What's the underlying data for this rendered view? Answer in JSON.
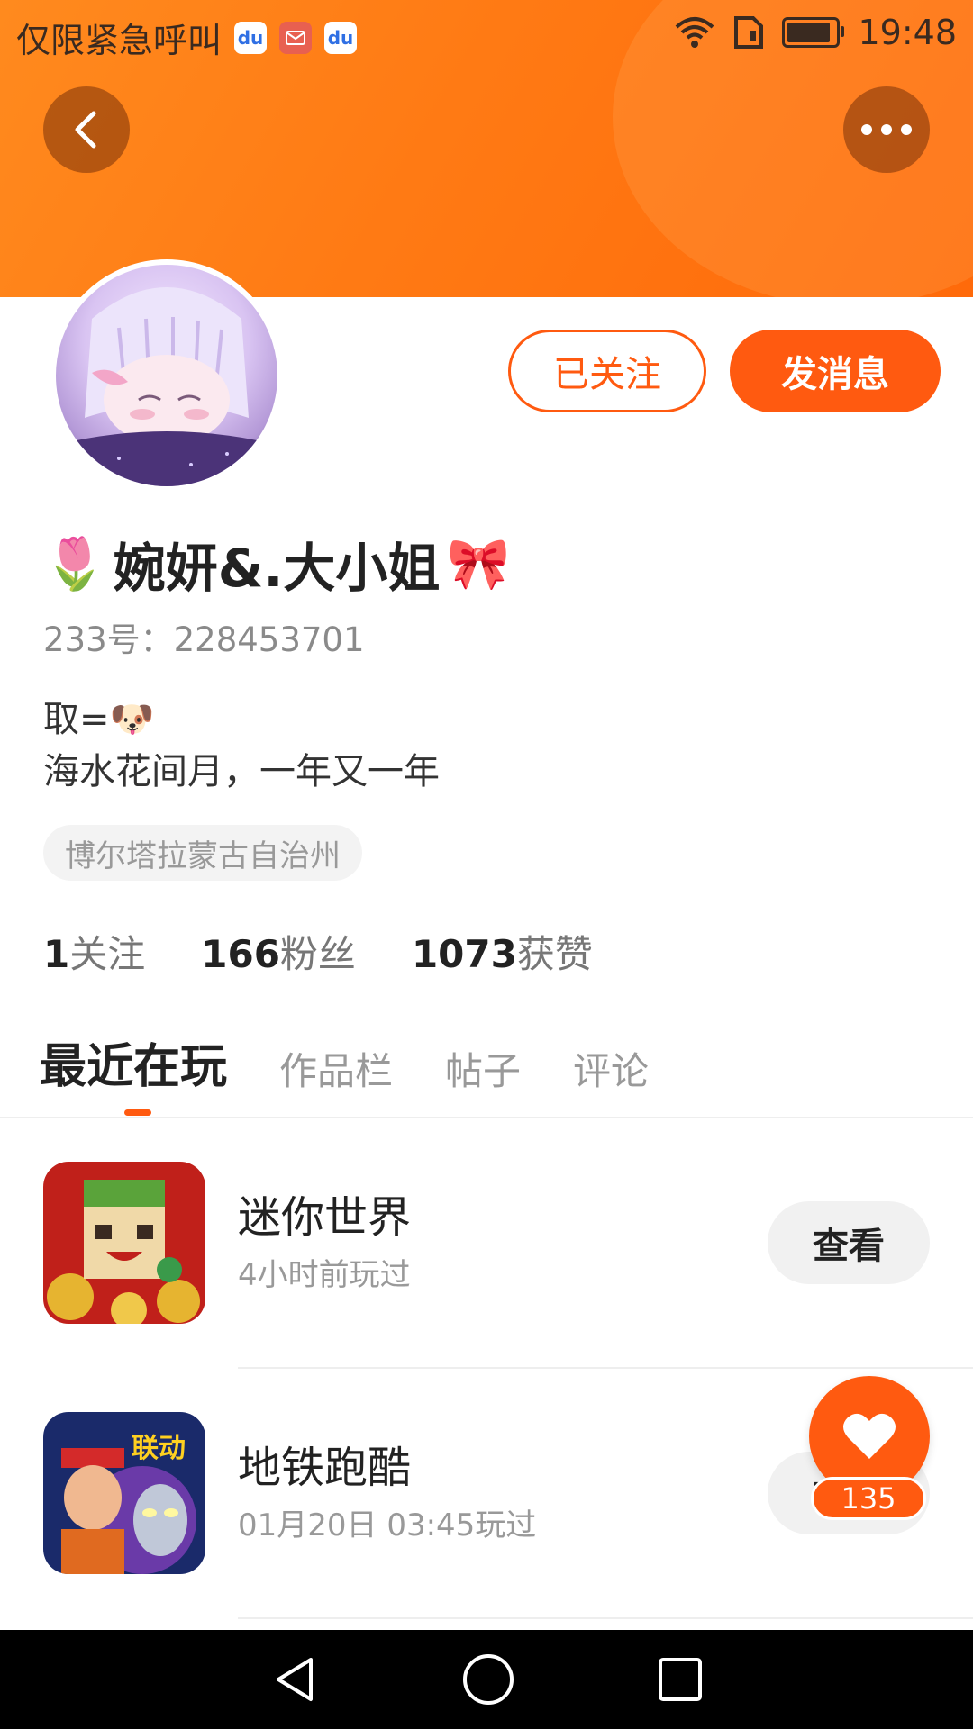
{
  "status_bar": {
    "carrier": "仅限紧急呼叫",
    "apps": [
      "baidu-icon",
      "mail-icon",
      "baidu-icon"
    ],
    "baidu_label": "du",
    "time": "19:48",
    "battery_level": 0.9
  },
  "header": {
    "back_icon": "chevron-left-icon",
    "more_icon": "more-horizontal-icon",
    "colors": {
      "start": "#ff8a1e",
      "end": "#ff6a0a"
    }
  },
  "profile": {
    "name": "婉妍&.大小姐",
    "name_prefix_emoji": "🌷",
    "name_suffix_emoji": "🎀",
    "uid": "233号：228453701",
    "bio_line1_text": "取=",
    "bio_line1_emoji": "🐶",
    "bio_line2": "海水花间月，一年又一年",
    "location": "博尔塔拉蒙古自治州",
    "follow_label": "已关注",
    "message_label": "发消息"
  },
  "stats": [
    {
      "num": "1",
      "label": "关注"
    },
    {
      "num": "166",
      "label": "粉丝"
    },
    {
      "num": "1073",
      "label": "获赞"
    }
  ],
  "tabs": [
    {
      "label": "最近在玩",
      "active": true
    },
    {
      "label": "作品栏",
      "active": false
    },
    {
      "label": "帖子",
      "active": false
    },
    {
      "label": "评论",
      "active": false
    }
  ],
  "games": [
    {
      "title": "迷你世界",
      "subtitle": "4小时前玩过",
      "button": "查看"
    },
    {
      "title": "地铁跑酷",
      "subtitle": "01月20日 03:45玩过",
      "button": "查看",
      "icon_badge": "联动"
    }
  ],
  "like_fab": {
    "icon": "heart-icon",
    "count": "135"
  },
  "accent_color": "#ff5a10",
  "nav_bar": {
    "back_icon": "triangle-back-icon",
    "home_icon": "circle-home-icon",
    "recent_icon": "square-recent-icon"
  }
}
